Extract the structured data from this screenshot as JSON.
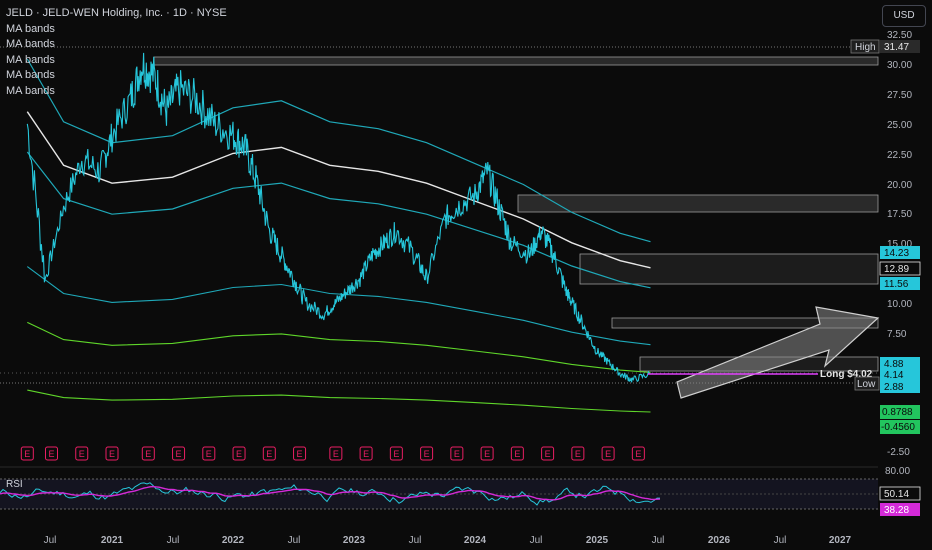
{
  "header": {
    "title": "JELD · JELD-WEN Holding, Inc. · 1D · NYSE",
    "indicators": [
      "MA bands",
      "MA bands",
      "MA bands",
      "MA bands",
      "MA bands"
    ],
    "currency_button": "USD"
  },
  "rsi_panel": {
    "label": "RSI"
  },
  "colors": {
    "price": "#26c6da",
    "ma_white": "#e6e6e6",
    "band_teal": "#1fa8b8",
    "band_green": "#5fd62a",
    "rsi_line": "#d42ad8",
    "position": "#e040fb",
    "earnings": "#e91e63",
    "green_label": "#22c55e"
  },
  "chart_data": {
    "type": "line",
    "title": "JELD · JELD-WEN Holding, Inc. · 1D · NYSE",
    "y_axis": {
      "ticks": [
        "32.50",
        "30.00",
        "27.50",
        "25.00",
        "22.50",
        "20.00",
        "17.50",
        "15.00",
        "10.00",
        "7.50",
        "5.00",
        "-2.50"
      ],
      "ylim": [
        -2.5,
        32.5
      ]
    },
    "x_axis": {
      "ticks": [
        "Jul",
        "2021",
        "Jul",
        "2022",
        "Jul",
        "2023",
        "Jul",
        "2024",
        "Jul",
        "2025",
        "Jul",
        "2026",
        "Jul",
        "2027"
      ]
    },
    "price_labels": {
      "high_tag": "High",
      "high": "31.47",
      "p1": "14.23",
      "p2": "12.89",
      "p3": "11.56",
      "p4": "4.88",
      "p5": "4.14",
      "low_tag": "Low",
      "low": "2.88",
      "g1": "0.8788",
      "g2": "-0.4560"
    },
    "position_label": "Long $4.02",
    "price_series": {
      "t": [
        2020.3,
        2020.45,
        2020.6,
        2020.75,
        2020.9,
        2021.0,
        2021.15,
        2021.25,
        2021.35,
        2021.45,
        2021.55,
        2021.7,
        2021.85,
        2022.0,
        2022.1,
        2022.2,
        2022.3,
        2022.4,
        2022.5,
        2022.6,
        2022.75,
        2022.85,
        2022.95,
        2023.05,
        2023.15,
        2023.25,
        2023.35,
        2023.5,
        2023.6,
        2023.75,
        2023.85,
        2024.0,
        2024.1,
        2024.2,
        2024.3,
        2024.45,
        2024.55,
        2024.65,
        2024.75,
        2024.8,
        2024.9,
        2025.0,
        2025.1,
        2025.2,
        2025.3,
        2025.45
      ],
      "v": [
        25,
        12,
        18,
        22,
        21,
        24,
        27,
        30,
        29,
        26,
        28,
        27,
        25,
        24,
        23,
        20,
        16,
        14,
        12,
        10,
        9,
        10,
        11,
        12,
        14,
        15,
        16,
        14,
        12,
        17,
        18,
        19,
        21,
        18,
        15,
        14,
        16,
        14,
        11,
        10,
        8,
        6,
        5,
        4,
        3.5,
        4.0
      ]
    },
    "ma_center": {
      "t": [
        2020.3,
        2020.6,
        2021.0,
        2021.5,
        2022.0,
        2022.4,
        2022.8,
        2023.2,
        2023.6,
        2024.0,
        2024.4,
        2024.8,
        2025.2,
        2025.45
      ],
      "v": [
        26,
        21.5,
        20,
        20.5,
        22.5,
        23,
        21.5,
        21,
        20,
        18.5,
        17,
        15,
        13.5,
        12.9
      ]
    },
    "earnings_markers": {
      "t": [
        2020.3,
        2020.5,
        2020.75,
        2021.0,
        2021.3,
        2021.55,
        2021.8,
        2022.05,
        2022.3,
        2022.55,
        2022.85,
        2023.1,
        2023.35,
        2023.6,
        2023.85,
        2024.1,
        2024.35,
        2024.6,
        2024.85,
        2025.1,
        2025.35
      ],
      "labels": [
        "E",
        "E",
        "E",
        "E",
        "E",
        "E",
        "E",
        "E",
        "E",
        "E",
        "E",
        "E",
        "E",
        "E",
        "E",
        "E",
        "E",
        "E",
        "E",
        "E",
        "E"
      ]
    },
    "rsi": {
      "ticks": [
        "80.00"
      ],
      "current": "50.14",
      "signal": "38.28",
      "ylim": [
        20,
        80
      ]
    }
  }
}
